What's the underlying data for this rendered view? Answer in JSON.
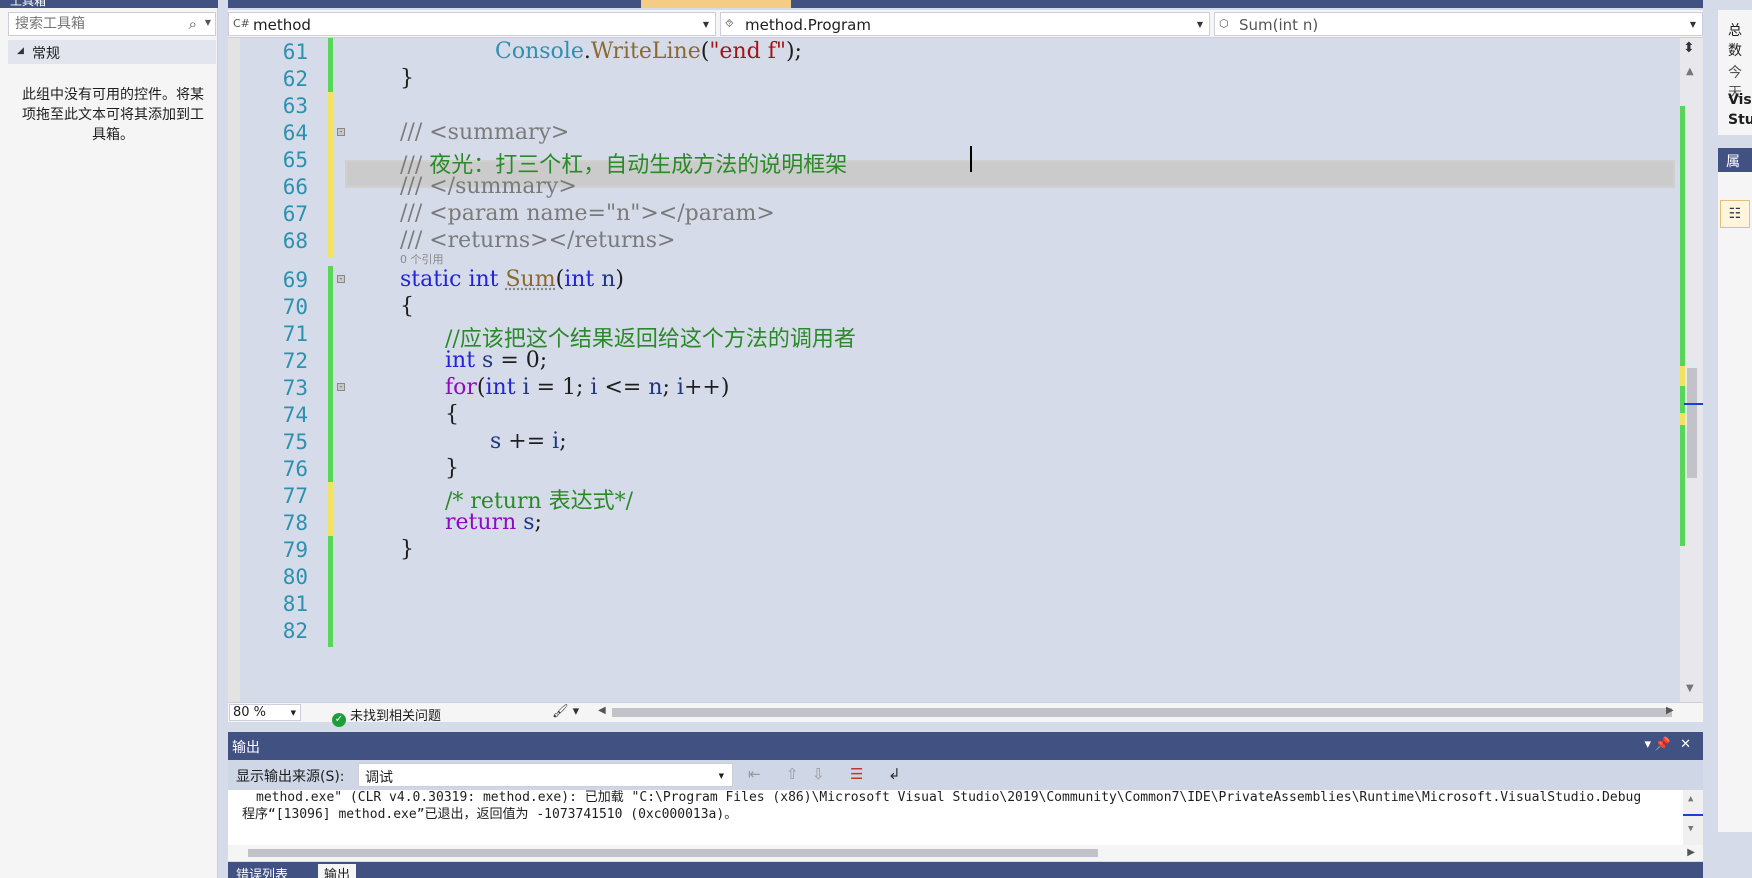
{
  "toolbox": {
    "title": "工具箱",
    "search_placeholder": "搜索工具箱",
    "group_label": "常规",
    "empty_message": "此组中没有可用的控件。将某项拖至此文本可将其添加到工具箱。"
  },
  "navbar": {
    "project": "method",
    "class": "method.Program",
    "member": "Sum(int n)"
  },
  "editor": {
    "ref_hint": "0 个引用",
    "lines": [
      {
        "n": "61"
      },
      {
        "n": "62"
      },
      {
        "n": "63"
      },
      {
        "n": "64"
      },
      {
        "n": "65"
      },
      {
        "n": "66"
      },
      {
        "n": "67"
      },
      {
        "n": "68"
      },
      {
        "n": "69"
      },
      {
        "n": "70"
      },
      {
        "n": "71"
      },
      {
        "n": "72"
      },
      {
        "n": "73"
      },
      {
        "n": "74"
      },
      {
        "n": "75"
      },
      {
        "n": "76"
      },
      {
        "n": "77"
      },
      {
        "n": "78"
      },
      {
        "n": "79"
      },
      {
        "n": "80"
      },
      {
        "n": "81"
      },
      {
        "n": "82"
      }
    ],
    "code": {
      "l61a": "Console",
      "l61b": ".",
      "l61c": "WriteLine",
      "l61d": "(",
      "l61e": "\"end f\"",
      "l61f": ");",
      "l62": "}",
      "l64": "/// <summary>",
      "l65a": "/// ",
      "l65b": "夜光：打三个杠，自动生成方法的说明框架",
      "l66": "/// </summary>",
      "l67": "/// <param name=\"n\"></param>",
      "l68": "/// <returns></returns>",
      "l69a": "static int ",
      "l69b": "Sum",
      "l69c": "(",
      "l69d": "int ",
      "l69e": "n",
      "l69f": ")",
      "l70": "{",
      "l71": "//应该把这个结果返回给这个方法的调用者",
      "l72a": "int ",
      "l72b": "s",
      "l72c": " = 0;",
      "l73a": "for",
      "l73b": "(",
      "l73c": "int ",
      "l73d": "i",
      "l73e": " = 1; ",
      "l73f": "i",
      "l73g": " <= ",
      "l73h": "n",
      "l73i": "; ",
      "l73j": "i",
      "l73k": "++)",
      "l74": "{",
      "l75a": "s",
      "l75b": " += ",
      "l75c": "i",
      "l75d": ";",
      "l76": "}",
      "l77": "/* return 表达式*/",
      "l78a": "return ",
      "l78b": "s",
      "l78c": ";",
      "l79": "}"
    }
  },
  "status": {
    "zoom": "80 %",
    "issues": "未找到相关问题"
  },
  "output": {
    "title": "输出",
    "source_label": "显示输出来源(S):",
    "source_value": "调试",
    "line1": "method.exe\" (CLR v4.0.30319: method.exe): 已加载 \"C:\\Program Files (x86)\\Microsoft Visual Studio\\2019\\Community\\Common7\\IDE\\PrivateAssemblies\\Runtime\\Microsoft.VisualStudio.Debug",
    "line2": "程序“[13096] method.exe”已退出，返回值为 -1073741510 (0xc000013a)。",
    "tabs": [
      "错误列表",
      "输出"
    ]
  },
  "right_panel": {
    "top_a": "总数",
    "top_b": "今天",
    "top_c1": "Visu",
    "top_c2": "Stu",
    "properties_title": "属性"
  },
  "colors": {
    "accent": "#405182",
    "editor_bg": "#c0c0c0",
    "keyword": "#2323d8",
    "comment": "#2a8a2a",
    "line_number": "#2b91af",
    "change_saved": "#57d657",
    "change_unsaved": "#f1e35f"
  },
  "icons": {
    "search": "search-icon",
    "csharp_file": "csharp-file-icon",
    "class": "class-icon",
    "method": "method-icon",
    "check": "check-circle-icon",
    "clear_all": "clear-all-icon",
    "word_wrap": "word-wrap-icon"
  }
}
